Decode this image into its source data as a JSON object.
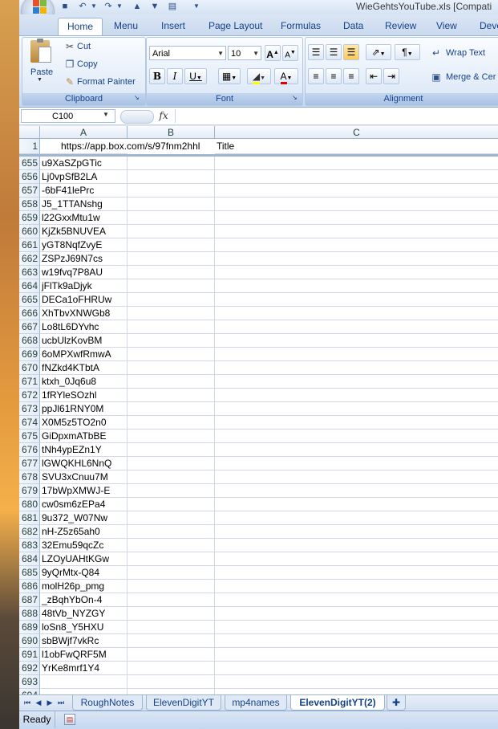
{
  "window": {
    "title": "WieGehtsYouTube.xls  [Compati"
  },
  "ribbon_tabs": [
    "Home",
    "Menu",
    "Insert",
    "Page Layout",
    "Formulas",
    "Data",
    "Review",
    "View",
    "Deve"
  ],
  "clipboard": {
    "paste": "Paste",
    "cut": "Cut",
    "copy": "Copy",
    "format_painter": "Format Painter",
    "label": "Clipboard"
  },
  "font": {
    "name": "Arial",
    "size": "10",
    "label": "Font",
    "bold": "B",
    "italic": "I",
    "underline": "U",
    "grow": "A",
    "shrink": "A",
    "font_color_glyph": "A"
  },
  "alignment": {
    "wrap_text": "Wrap Text",
    "merge": "Merge & Cer",
    "label": "Alignment"
  },
  "formula_bar": {
    "cell_ref": "C100",
    "fx": "fx",
    "content": ""
  },
  "columns": [
    "A",
    "B",
    "C"
  ],
  "frozen_row": {
    "num": "1",
    "a": "https://app.box.com/s/97fnm2hhl",
    "b": "Title"
  },
  "rows": [
    {
      "num": "655",
      "a": "u9XaSZpGTic"
    },
    {
      "num": "656",
      "a": "Lj0vpSfB2LA"
    },
    {
      "num": "657",
      "a": "-6bF41lePrc"
    },
    {
      "num": "658",
      "a": "J5_1TTANshg"
    },
    {
      "num": "659",
      "a": "l22GxxMtu1w"
    },
    {
      "num": "660",
      "a": "KjZk5BNUVEA"
    },
    {
      "num": "661",
      "a": "yGT8NqfZvyE"
    },
    {
      "num": "662",
      "a": "ZSPzJ69N7cs"
    },
    {
      "num": "663",
      "a": "w19fvq7P8AU"
    },
    {
      "num": "664",
      "a": "jFlTk9aDjyk"
    },
    {
      "num": "665",
      "a": "DECa1oFHRUw"
    },
    {
      "num": "666",
      "a": "XhTbvXNWGb8"
    },
    {
      "num": "667",
      "a": "Lo8tL6DYvhc"
    },
    {
      "num": "668",
      "a": "ucbUlzKovBM"
    },
    {
      "num": "669",
      "a": "6oMPXwfRmwA"
    },
    {
      "num": "670",
      "a": "fNZkd4KTbtA"
    },
    {
      "num": "671",
      "a": "ktxh_0Jq6u8"
    },
    {
      "num": "672",
      "a": "1fRYleSOzhl"
    },
    {
      "num": "673",
      "a": "ppJl61RNY0M"
    },
    {
      "num": "674",
      "a": "X0M5z5TO2n0"
    },
    {
      "num": "675",
      "a": "GiDpxmATbBE"
    },
    {
      "num": "676",
      "a": "tNh4ypEZn1Y"
    },
    {
      "num": "677",
      "a": "lGWQKHL6NnQ"
    },
    {
      "num": "678",
      "a": "SVU3xCnuu7M"
    },
    {
      "num": "679",
      "a": "17bWpXMWJ-E"
    },
    {
      "num": "680",
      "a": "cw0sm6zEPa4"
    },
    {
      "num": "681",
      "a": "9u372_W07Nw"
    },
    {
      "num": "682",
      "a": "nH-Z5z65ah0"
    },
    {
      "num": "683",
      "a": "32Emu59qcZc"
    },
    {
      "num": "684",
      "a": "LZOyUAHtKGw"
    },
    {
      "num": "685",
      "a": "9yQrMtx-Q84"
    },
    {
      "num": "686",
      "a": "molH26p_pmg"
    },
    {
      "num": "687",
      "a": "_zBqhYbOn-4"
    },
    {
      "num": "688",
      "a": "48tVb_NYZGY"
    },
    {
      "num": "689",
      "a": "loSn8_Y5HXU"
    },
    {
      "num": "690",
      "a": "sbBWjf7vkRc"
    },
    {
      "num": "691",
      "a": "l1obFwQRF5M"
    },
    {
      "num": "692",
      "a": "YrKe8mrf1Y4"
    },
    {
      "num": "693",
      "a": ""
    },
    {
      "num": "694",
      "a": ""
    }
  ],
  "sheets": [
    "RoughNotes",
    "ElevenDigitYT",
    "mp4names",
    "ElevenDigitYT(2)"
  ],
  "active_sheet": "ElevenDigitYT(2)",
  "status": {
    "mode": "Ready"
  }
}
